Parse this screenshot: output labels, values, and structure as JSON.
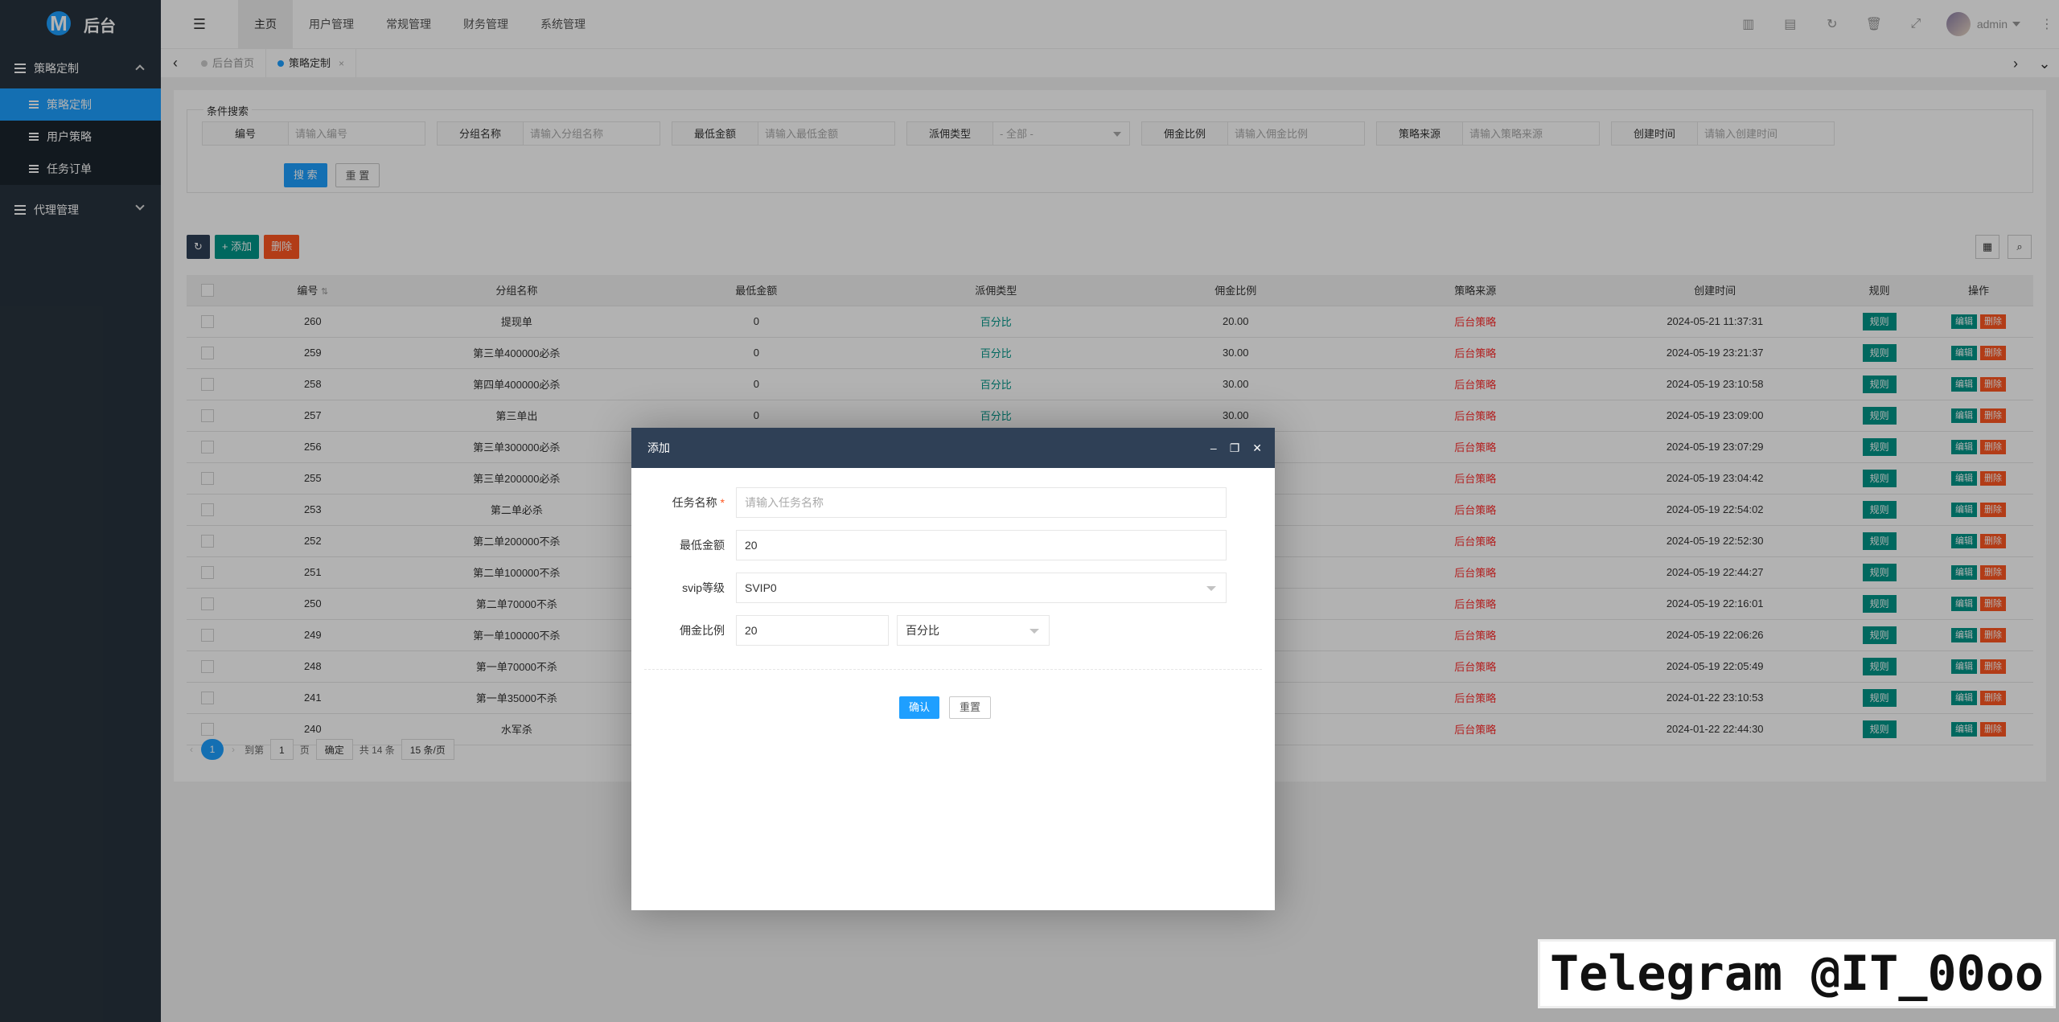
{
  "app": {
    "logo_letter": "M",
    "title": "后台"
  },
  "sidebar": {
    "groups": [
      {
        "label": "策略定制",
        "items": [
          "策略定制",
          "用户策略",
          "任务订单"
        ]
      },
      {
        "label": "代理管理"
      }
    ]
  },
  "topnav": {
    "flexible_icon": "☰",
    "items": [
      "主页",
      "用户管理",
      "常规管理",
      "财务管理",
      "系统管理"
    ],
    "user": "admin"
  },
  "tabs": {
    "items": [
      "后台首页",
      "策略定制"
    ],
    "close": "×"
  },
  "search": {
    "legend": "条件搜索",
    "fields": [
      {
        "label": "编号",
        "placeholder": "请输入编号"
      },
      {
        "label": "分组名称",
        "placeholder": "请输入分组名称"
      },
      {
        "label": "最低金额",
        "placeholder": "请输入最低金额"
      },
      {
        "label": "派佣类型",
        "placeholder": "- 全部 -"
      },
      {
        "label": "佣金比例",
        "placeholder": "请输入佣金比例"
      },
      {
        "label": "策略来源",
        "placeholder": "请输入策略来源"
      },
      {
        "label": "创建时间",
        "placeholder": "请输入创建时间"
      }
    ],
    "search_btn": "搜 索",
    "reset_btn": "重 置"
  },
  "toolbar": {
    "add": "+ 添加",
    "delete": "删除"
  },
  "table": {
    "headers": [
      "编号",
      "分组名称",
      "最低金额",
      "派佣类型",
      "佣金比例",
      "策略来源",
      "创建时间",
      "规则",
      "操作"
    ],
    "rule_btn": "规则",
    "edit_btn": "编辑",
    "del_btn": "删除",
    "rows": [
      {
        "id": "260",
        "name": "提现单",
        "min": "0",
        "type": "百分比",
        "ratio": "20.00",
        "source": "后台策略",
        "time": "2024-05-21 11:37:31"
      },
      {
        "id": "259",
        "name": "第三单400000必杀",
        "min": "0",
        "type": "百分比",
        "ratio": "30.00",
        "source": "后台策略",
        "time": "2024-05-19 23:21:37"
      },
      {
        "id": "258",
        "name": "第四单400000必杀",
        "min": "0",
        "type": "百分比",
        "ratio": "30.00",
        "source": "后台策略",
        "time": "2024-05-19 23:10:58"
      },
      {
        "id": "257",
        "name": "第三单出",
        "min": "0",
        "type": "百分比",
        "ratio": "30.00",
        "source": "后台策略",
        "time": "2024-05-19 23:09:00"
      },
      {
        "id": "256",
        "name": "第三单300000必杀",
        "min": "",
        "type": "",
        "ratio": "",
        "source": "后台策略",
        "time": "2024-05-19 23:07:29"
      },
      {
        "id": "255",
        "name": "第三单200000必杀",
        "min": "",
        "type": "",
        "ratio": "",
        "source": "后台策略",
        "time": "2024-05-19 23:04:42"
      },
      {
        "id": "253",
        "name": "第二单必杀",
        "min": "",
        "type": "",
        "ratio": "",
        "source": "后台策略",
        "time": "2024-05-19 22:54:02"
      },
      {
        "id": "252",
        "name": "第二单200000不杀",
        "min": "",
        "type": "",
        "ratio": "",
        "source": "后台策略",
        "time": "2024-05-19 22:52:30"
      },
      {
        "id": "251",
        "name": "第二单100000不杀",
        "min": "",
        "type": "",
        "ratio": "",
        "source": "后台策略",
        "time": "2024-05-19 22:44:27"
      },
      {
        "id": "250",
        "name": "第二单70000不杀",
        "min": "",
        "type": "",
        "ratio": "",
        "source": "后台策略",
        "time": "2024-05-19 22:16:01"
      },
      {
        "id": "249",
        "name": "第一单100000不杀",
        "min": "",
        "type": "",
        "ratio": "",
        "source": "后台策略",
        "time": "2024-05-19 22:06:26"
      },
      {
        "id": "248",
        "name": "第一单70000不杀",
        "min": "",
        "type": "",
        "ratio": "",
        "source": "后台策略",
        "time": "2024-05-19 22:05:49"
      },
      {
        "id": "241",
        "name": "第一单35000不杀",
        "min": "",
        "type": "",
        "ratio": "",
        "source": "后台策略",
        "time": "2024-01-22 23:10:53"
      },
      {
        "id": "240",
        "name": "水军杀",
        "min": "",
        "type": "",
        "ratio": "",
        "source": "后台策略",
        "time": "2024-01-22 22:44:30"
      }
    ]
  },
  "pager": {
    "current": "1",
    "goto": "到第",
    "page_input": "1",
    "page_unit": "页",
    "confirm": "确定",
    "total": "共 14 条",
    "per_page": "15 条/页"
  },
  "modal": {
    "title": "添加",
    "fields": [
      {
        "label": "任务名称",
        "placeholder": "请输入任务名称",
        "required": "*"
      },
      {
        "label": "最低金额",
        "value": "20"
      },
      {
        "label": "svip等级",
        "value": "SVIP0"
      },
      {
        "label": "佣金比例",
        "value": "20",
        "type_value": "百分比"
      }
    ],
    "confirm": "确认",
    "reset": "重置"
  },
  "watermark": "Telegram @IT_00oo",
  "colors": {
    "sidebar": "#28333e",
    "accent": "#1e9fff",
    "green": "#009688",
    "red": "#ff5722",
    "modal_head": "#2f4056"
  }
}
